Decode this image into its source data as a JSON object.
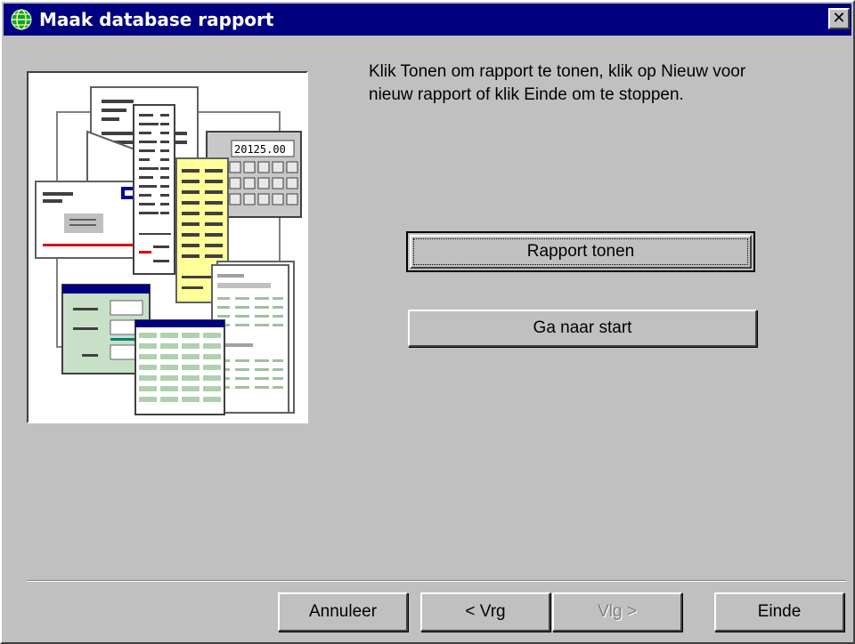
{
  "window": {
    "title": "Maak database rapport",
    "close_glyph": "✕",
    "app_icon": "globe-icon"
  },
  "main": {
    "instruction": "Klik Tonen om rapport te tonen, klik op Nieuw voor\nnieuw rapport of klik Einde om te stoppen.",
    "calculator_display": "20125.00",
    "buttons": {
      "show_report": "Rapport tonen",
      "go_to_start": "Ga naar start"
    }
  },
  "footer": {
    "cancel": "Annuleer",
    "back": "< Vrg",
    "next": "Vlg >",
    "finish": "Einde"
  },
  "colors": {
    "face": "#c0c0c0",
    "titlebar": "#000080",
    "highlight": "#ffffff",
    "shadow": "#404040"
  }
}
